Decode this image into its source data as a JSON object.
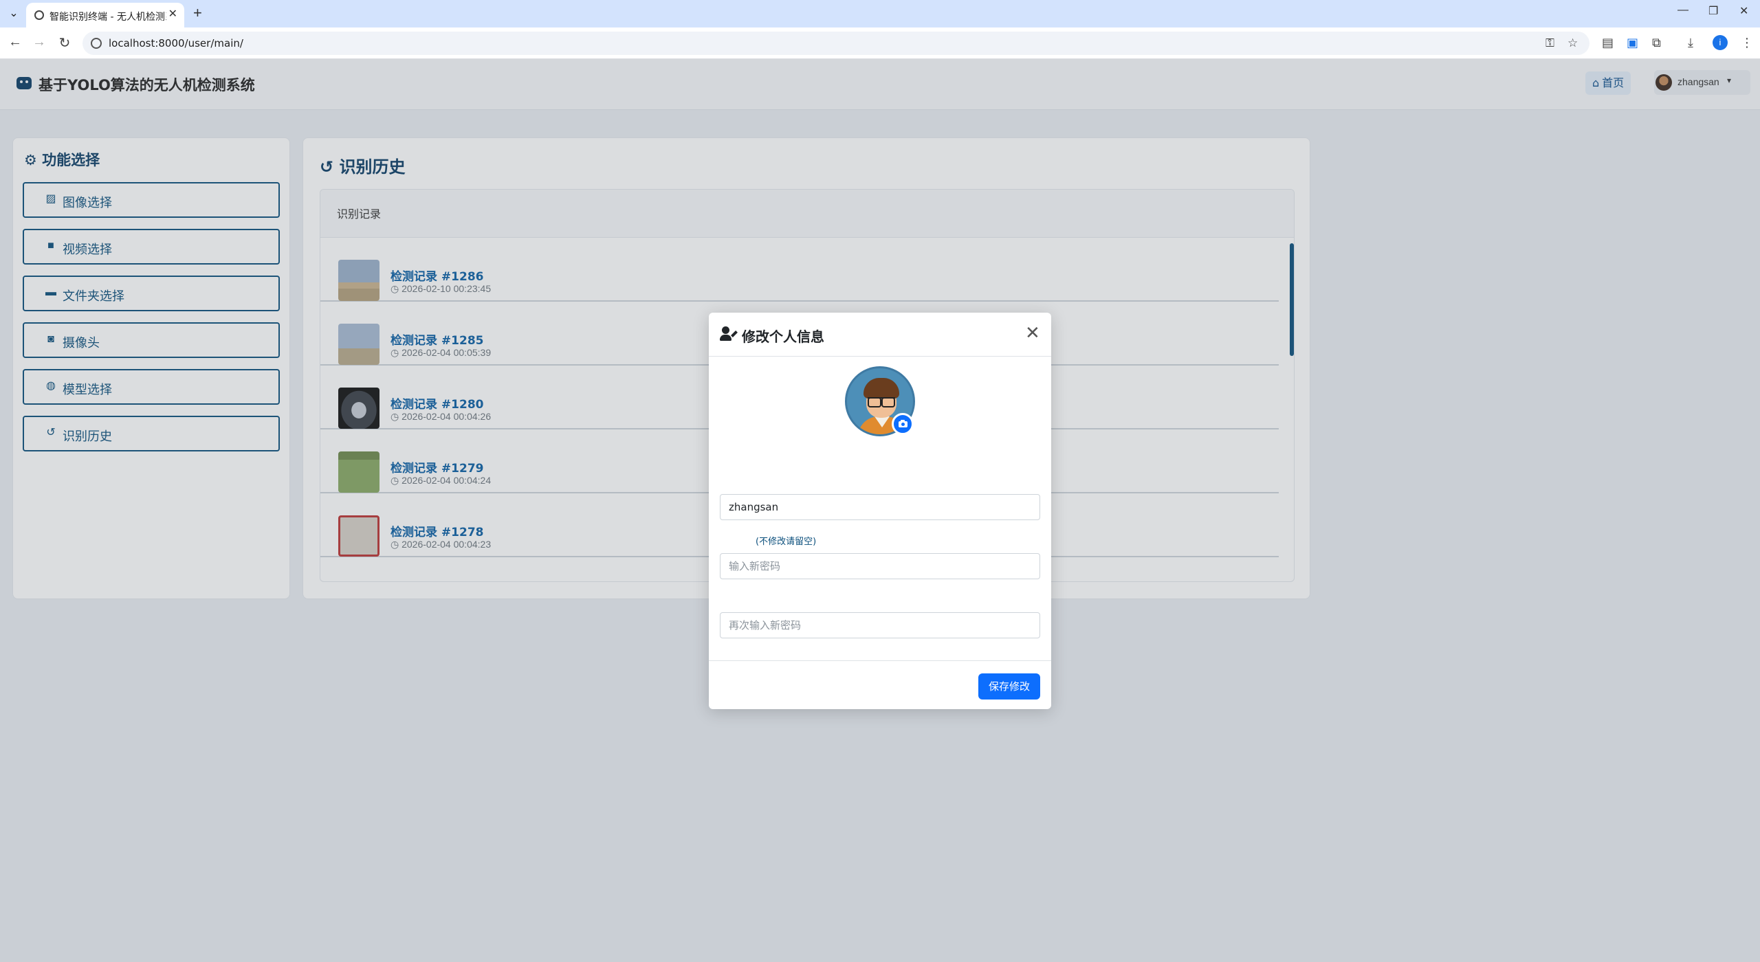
{
  "browser": {
    "tab_title": "智能识别终端 - 无人机检测系统",
    "url": "localhost:8000/user/main/",
    "profile_initial": "i"
  },
  "header": {
    "title": "基于YOLO算法的无人机检测系统",
    "home_label": "首页",
    "username": "zhangsan"
  },
  "sidebar": {
    "title": "功能选择",
    "items": [
      {
        "label": "图像选择",
        "icon": "image-icon"
      },
      {
        "label": "视频选择",
        "icon": "video-icon"
      },
      {
        "label": "文件夹选择",
        "icon": "folder-icon"
      },
      {
        "label": "摄像头",
        "icon": "camera-icon"
      },
      {
        "label": "模型选择",
        "icon": "brain-icon"
      },
      {
        "label": "识别历史",
        "icon": "history-icon"
      }
    ]
  },
  "main": {
    "title": "识别历史",
    "card_header": "识别记录",
    "records": [
      {
        "title": "检测记录 #1286",
        "time": "2026-02-10 00:23:45"
      },
      {
        "title": "检测记录 #1285",
        "time": "2026-02-04 00:05:39"
      },
      {
        "title": "检测记录 #1280",
        "time": "2026-02-04 00:04:26"
      },
      {
        "title": "检测记录 #1279",
        "time": "2026-02-04 00:04:24"
      },
      {
        "title": "检测记录 #1278",
        "time": "2026-02-04 00:04:23"
      }
    ]
  },
  "modal": {
    "title": "修改个人信息",
    "username_value": "zhangsan",
    "password_hint": "(不修改请留空)",
    "new_password_placeholder": "输入新密码",
    "confirm_password_placeholder": "再次输入新密码",
    "save_label": "保存修改"
  },
  "colors": {
    "primary": "#0d6efd",
    "brand": "#0b3d66",
    "sidebar_accent": "#0b4f7c",
    "record_title": "#0b5fa5"
  }
}
